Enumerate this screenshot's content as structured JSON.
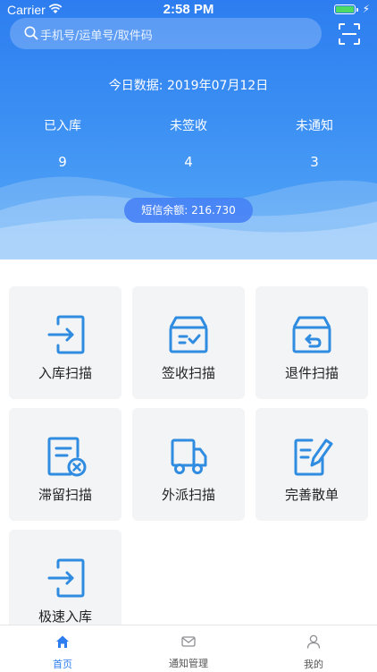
{
  "status_bar": {
    "carrier": "Carrier",
    "time": "2:58 PM"
  },
  "search": {
    "placeholder": "手机号/运单号/取件码"
  },
  "today": {
    "text": "今日数据: 2019年07月12日"
  },
  "stats": [
    {
      "label": "已入库",
      "value": "9"
    },
    {
      "label": "未签收",
      "value": "4"
    },
    {
      "label": "未通知",
      "value": "3"
    }
  ],
  "sms": {
    "text": "短信余额:  216.730"
  },
  "tiles": [
    {
      "label": "入库扫描",
      "icon": "inbound-scan-icon"
    },
    {
      "label": "签收扫描",
      "icon": "sign-scan-icon"
    },
    {
      "label": "退件扫描",
      "icon": "return-scan-icon"
    },
    {
      "label": "滞留扫描",
      "icon": "stranded-scan-icon"
    },
    {
      "label": "外派扫描",
      "icon": "dispatch-truck-icon"
    },
    {
      "label": "完善散单",
      "icon": "edit-document-icon"
    },
    {
      "label": "极速入库",
      "icon": "fast-inbound-icon"
    }
  ],
  "tabbar": [
    {
      "label": "首页",
      "icon": "home-icon",
      "active": true
    },
    {
      "label": "通知管理",
      "icon": "mail-icon",
      "active": false
    },
    {
      "label": "我的",
      "icon": "user-icon",
      "active": false
    }
  ],
  "colors": {
    "primary": "#2d7df0",
    "icon": "#2f8ce0",
    "tab_active": "#2d7df0",
    "tab_inactive": "#8e8e93"
  }
}
